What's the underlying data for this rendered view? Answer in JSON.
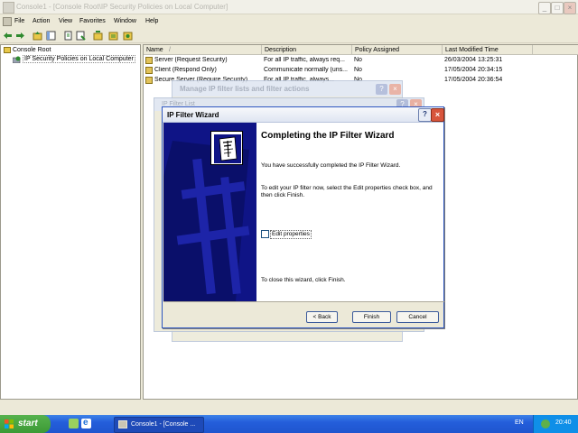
{
  "window": {
    "title": "Console1 - [Console Root\\IP Security Policies on Local Computer]"
  },
  "menu": [
    "File",
    "Action",
    "View",
    "Favorites",
    "Window",
    "Help"
  ],
  "tree": {
    "root": "Console Root",
    "child": "IP Security Policies on Local Computer"
  },
  "list": {
    "columns": [
      "Name",
      "Description",
      "Policy Assigned",
      "Last Modified Time"
    ],
    "rows": [
      {
        "name": "Server (Request Security)",
        "description": "For all IP traffic, always req...",
        "assigned": "No",
        "modified": "26/03/2004 13:25:31"
      },
      {
        "name": "Client (Respond Only)",
        "description": "Communicate normally (uns...",
        "assigned": "No",
        "modified": "17/05/2004 20:34:15"
      },
      {
        "name": "Secure Server (Require Security)",
        "description": "For all IP traffic, always...",
        "assigned": "No",
        "modified": "17/05/2004 20:36:54"
      }
    ]
  },
  "back_dialog_1": {
    "title": "Manage IP filter lists and filter actions"
  },
  "back_dialog_2": {
    "title": "IP Filter List"
  },
  "wizard": {
    "title": "IP Filter Wizard",
    "heading": "Completing the IP Filter Wizard",
    "text1": "You have successfully completed the IP Filter Wizard.",
    "text2": "To edit your IP filter now, select the Edit properties check box, and then click Finish.",
    "checkbox_label": "Edit properties",
    "checkbox_checked": false,
    "text3": "To close this wizard, click Finish.",
    "back_label": "< Back",
    "finish_label": "Finish",
    "cancel_label": "Cancel"
  },
  "taskbar": {
    "start_label": "start",
    "task_label": "Console1 - [Console ...",
    "language": "EN",
    "clock": "20:40"
  },
  "colors": {
    "wizard_side": "#0f1486",
    "taskbar": "#245edb",
    "start": "#3c9a35"
  }
}
